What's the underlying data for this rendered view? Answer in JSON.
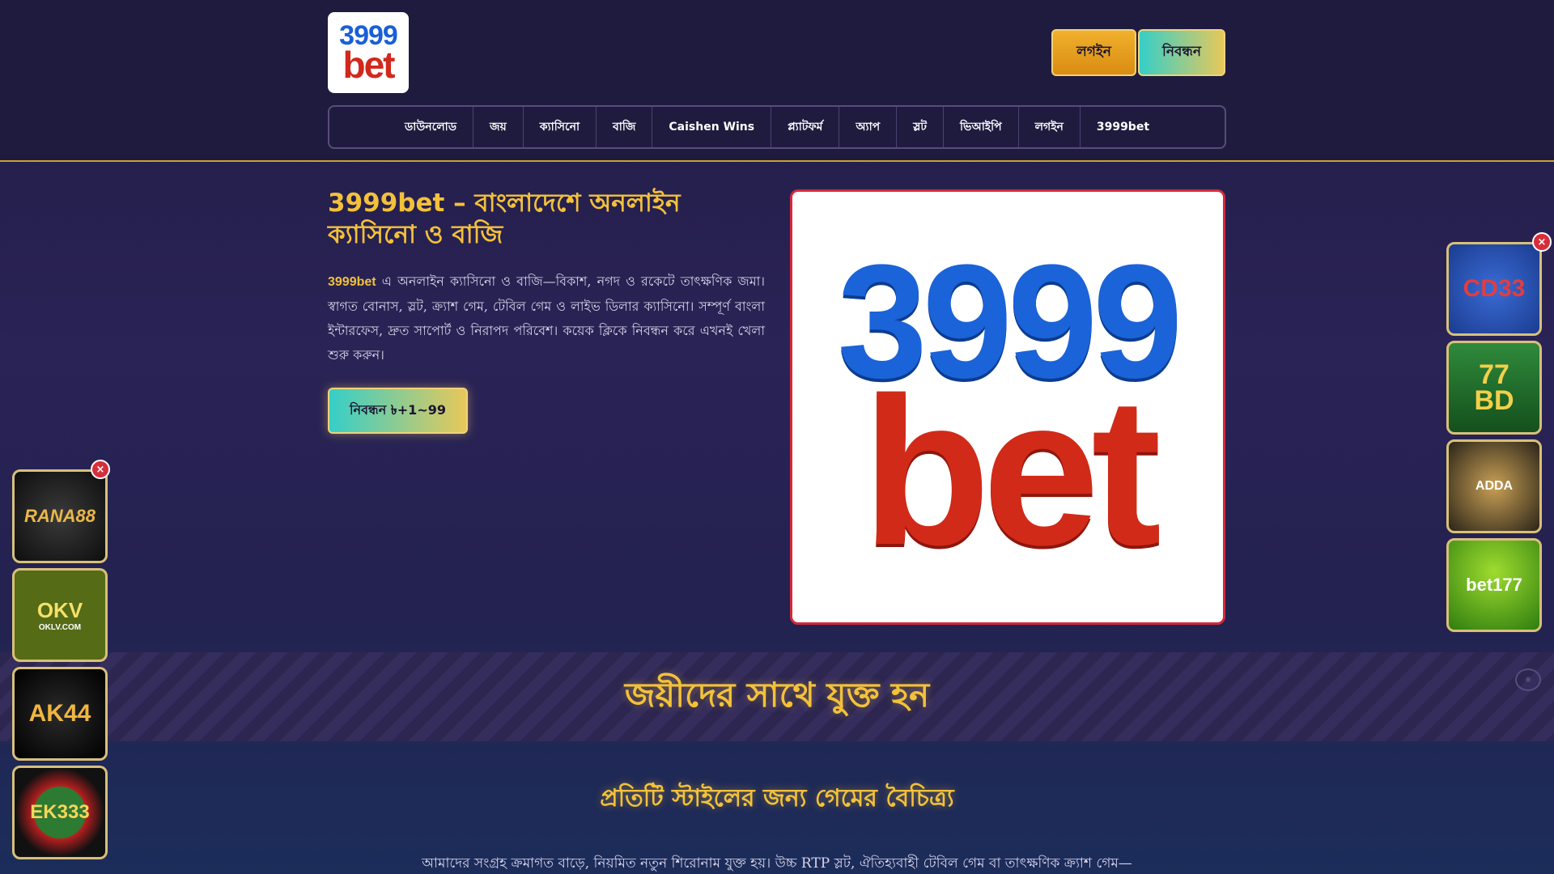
{
  "header": {
    "logo": {
      "top": "3999",
      "bottom": "bet"
    },
    "login_label": "লগইন",
    "register_label": "নিবন্ধন"
  },
  "nav": {
    "items": [
      "ডাউনলোড",
      "জয়",
      "ক্যাসিনো",
      "বাজি",
      "Caishen Wins",
      "প্ল্যাটফর্ম",
      "অ্যাপ",
      "স্লট",
      "ভিআইপি",
      "লগইন",
      "3999bet"
    ]
  },
  "hero": {
    "title": "3999bet – বাংলাদেশে অনলাইন ক্যাসিনো ও বাজি",
    "brand": "3999bet",
    "description": "এ অনলাইন ক্যাসিনো ও বাজি—বিকাশ, নগদ ও রকেটে তাৎক্ষণিক জমা। স্বাগত বোনাস, স্লট, ক্র্যাশ গেম, টেবিল গেম ও লাইভ ডিলার ক্যাসিনো। সম্পূর্ণ বাংলা ইন্টারফেস, দ্রুত সাপোর্ট ও নিরাপদ পরিবেশ। কয়েক ক্লিকে নিবন্ধন করে এখনই খেলা শুরু করুন।",
    "cta_label": "নিবন্ধন ৳+1~99",
    "image": {
      "top": "3999",
      "bottom": "bet"
    }
  },
  "banner": {
    "title": "জয়ীদের সাথে যুক্ত হন"
  },
  "games_section": {
    "title": "প্রতিটি স্টাইলের জন্য গেমের বৈচিত্র্য",
    "description": "আমাদের সংগ্রহ ক্রমাগত বাড়ে, নিয়মিত নতুন শিরোনাম যুক্ত হয়। উচ্চ RTP স্লট, ঐতিহ্যবাহী টেবিল গেম বা তাৎক্ষণিক ক্র্যাশ গেম—"
  },
  "ads": {
    "close_symbol": "×",
    "left": [
      {
        "text": "RANA88"
      },
      {
        "text": "OKV",
        "sub": "OKLV.COM"
      },
      {
        "text": "AK44"
      },
      {
        "text": "EK333"
      }
    ],
    "right": [
      {
        "text": "CD33"
      },
      {
        "text": "77",
        "sub": "BD"
      },
      {
        "text": "ADDA"
      },
      {
        "text": "bet177"
      }
    ]
  }
}
